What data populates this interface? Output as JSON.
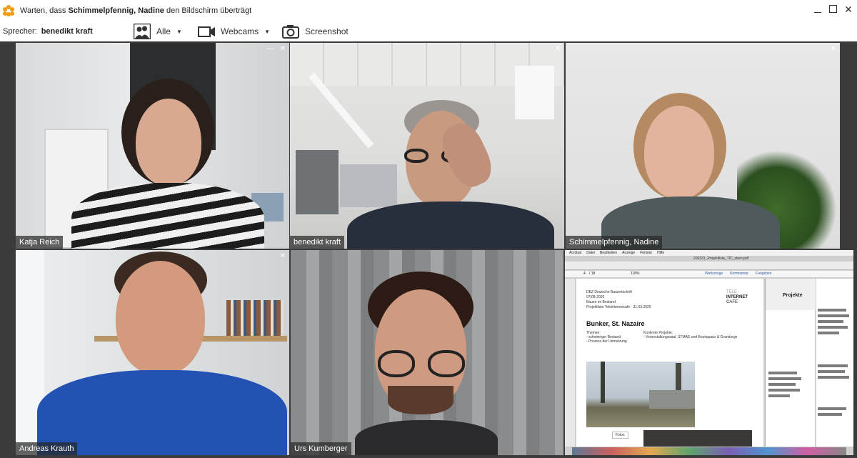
{
  "titlebar": {
    "prefix": "Warten, dass ",
    "presenter": "Schimmelpfennig, Nadine",
    "suffix": " den Bildschirm überträgt",
    "icon": "flower-icon"
  },
  "toolbar": {
    "speaker_label": "Sprecher:",
    "speaker_name": "benedikt kraft",
    "all_label": "Alle",
    "webcams_label": "Webcams",
    "screenshot_label": "Screenshot"
  },
  "tiles": [
    {
      "name": "Katja Reich"
    },
    {
      "name": "benedikt kraft"
    },
    {
      "name": "Schimmelpfennig, Nadine"
    },
    {
      "name": "Andreas Krauth"
    },
    {
      "name": "Urs Kumberger"
    }
  ],
  "shared_screen": {
    "menu": [
      "Acrobat",
      "Datei",
      "Bearbeiten",
      "Anzeige",
      "Fenster",
      "Hilfe"
    ],
    "file_name": "200331_Projektliste_TIC_stern.pdf",
    "toolbar_items": [
      "Werkzeuge",
      "Kommentar",
      "Freigeben"
    ],
    "page_current": "4",
    "page_total": "/ 18",
    "zoom": "118%",
    "doc_header": [
      "DBZ Deutsche Bauzeitschrift",
      "07/08-2020",
      "Bauen im Bestand",
      "Projektliste Teleinternetcafe · 31.03.2020"
    ],
    "brand": [
      "TELE",
      "INTERNET",
      "CAFE"
    ],
    "heading": "Bunker, St. Nazaire",
    "themes_label": "Themen:",
    "themes": [
      "- schwieriger Bestand",
      "- Prozess der Umnutzung"
    ],
    "projects_label": "Konkrete Projekte:",
    "projects": [
      "- Veranstaltungssaal, STMAE und Boutiquaux & Grandorge"
    ],
    "side_heading": "Projekte",
    "button": "Fotos"
  },
  "colors": {
    "active_border": "#2aa06c",
    "grid_bg": "#3b3b3b"
  }
}
